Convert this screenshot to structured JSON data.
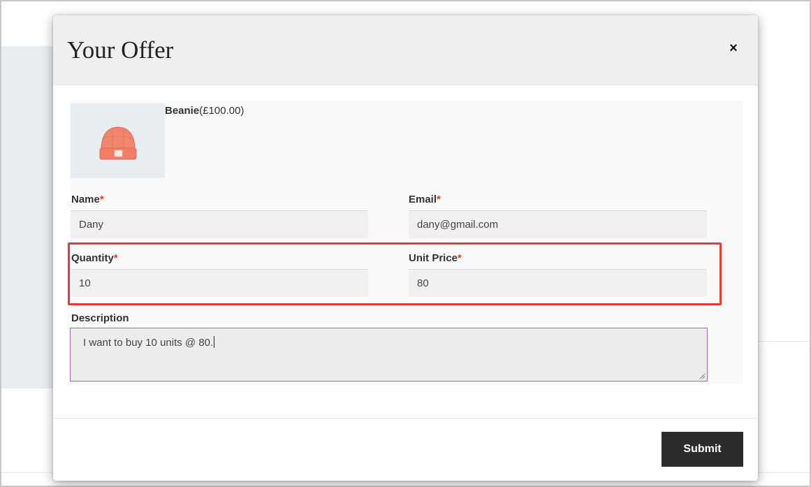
{
  "modal": {
    "title": "Your Offer",
    "close_label": "×"
  },
  "product": {
    "name": "Beanie",
    "price": "(£100.00)",
    "image_icon": "beanie-hat-icon"
  },
  "form": {
    "name": {
      "label": "Name",
      "required": "*",
      "value": "Dany"
    },
    "email": {
      "label": "Email",
      "required": "*",
      "value": "dany@gmail.com"
    },
    "quantity": {
      "label": "Quantity",
      "required": "*",
      "value": "10"
    },
    "unit_price": {
      "label": "Unit Price",
      "required": "*",
      "value": "80"
    },
    "description": {
      "label": "Description",
      "value": "I want to buy 10 units @ 80."
    }
  },
  "footer": {
    "submit_label": "Submit"
  },
  "colors": {
    "required": "#e2401c",
    "highlight": "#e8383b",
    "submit_bg": "#2b2b2b",
    "textarea_border": "#a069a0"
  }
}
